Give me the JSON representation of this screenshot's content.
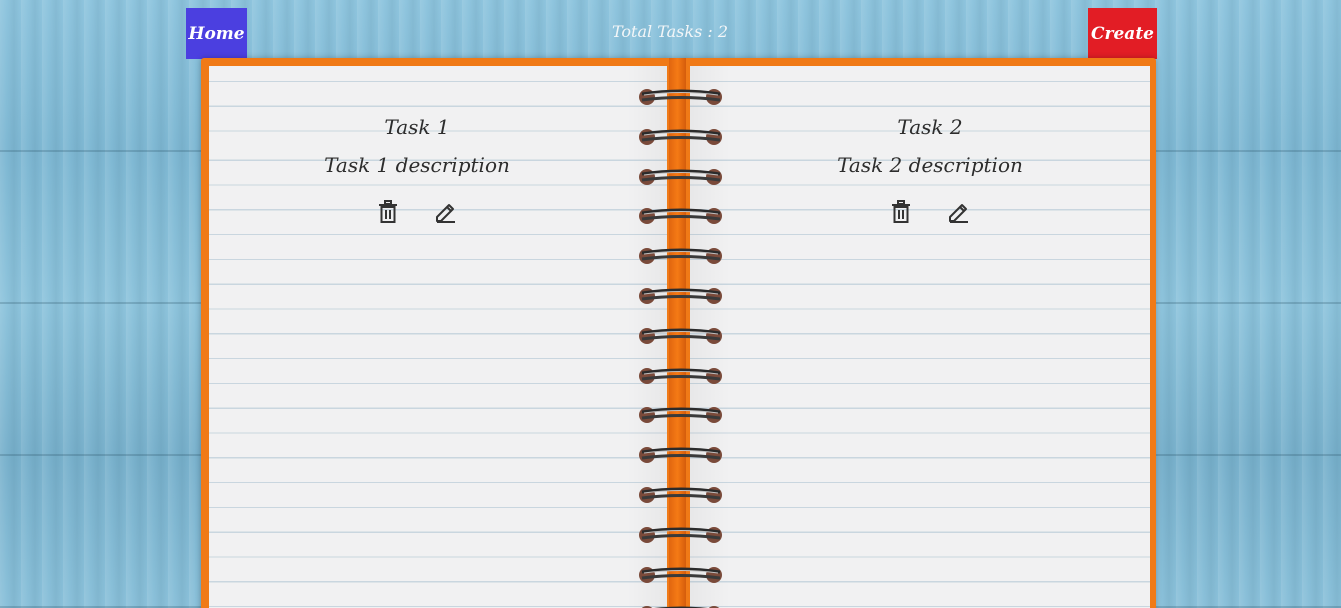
{
  "header": {
    "home_label": "Home",
    "total_label": "Total Tasks : 2",
    "create_label": "Create"
  },
  "tasks": [
    {
      "title": "Task 1",
      "description": "Task 1 description",
      "delete_icon": "trash-icon",
      "edit_icon": "pencil-icon"
    },
    {
      "title": "Task 2",
      "description": "Task 2 description",
      "delete_icon": "trash-icon",
      "edit_icon": "pencil-icon"
    }
  ],
  "colors": {
    "home_button": "#4b3fe0",
    "create_button": "#e21d25",
    "notebook_cover": "#f07a17"
  }
}
